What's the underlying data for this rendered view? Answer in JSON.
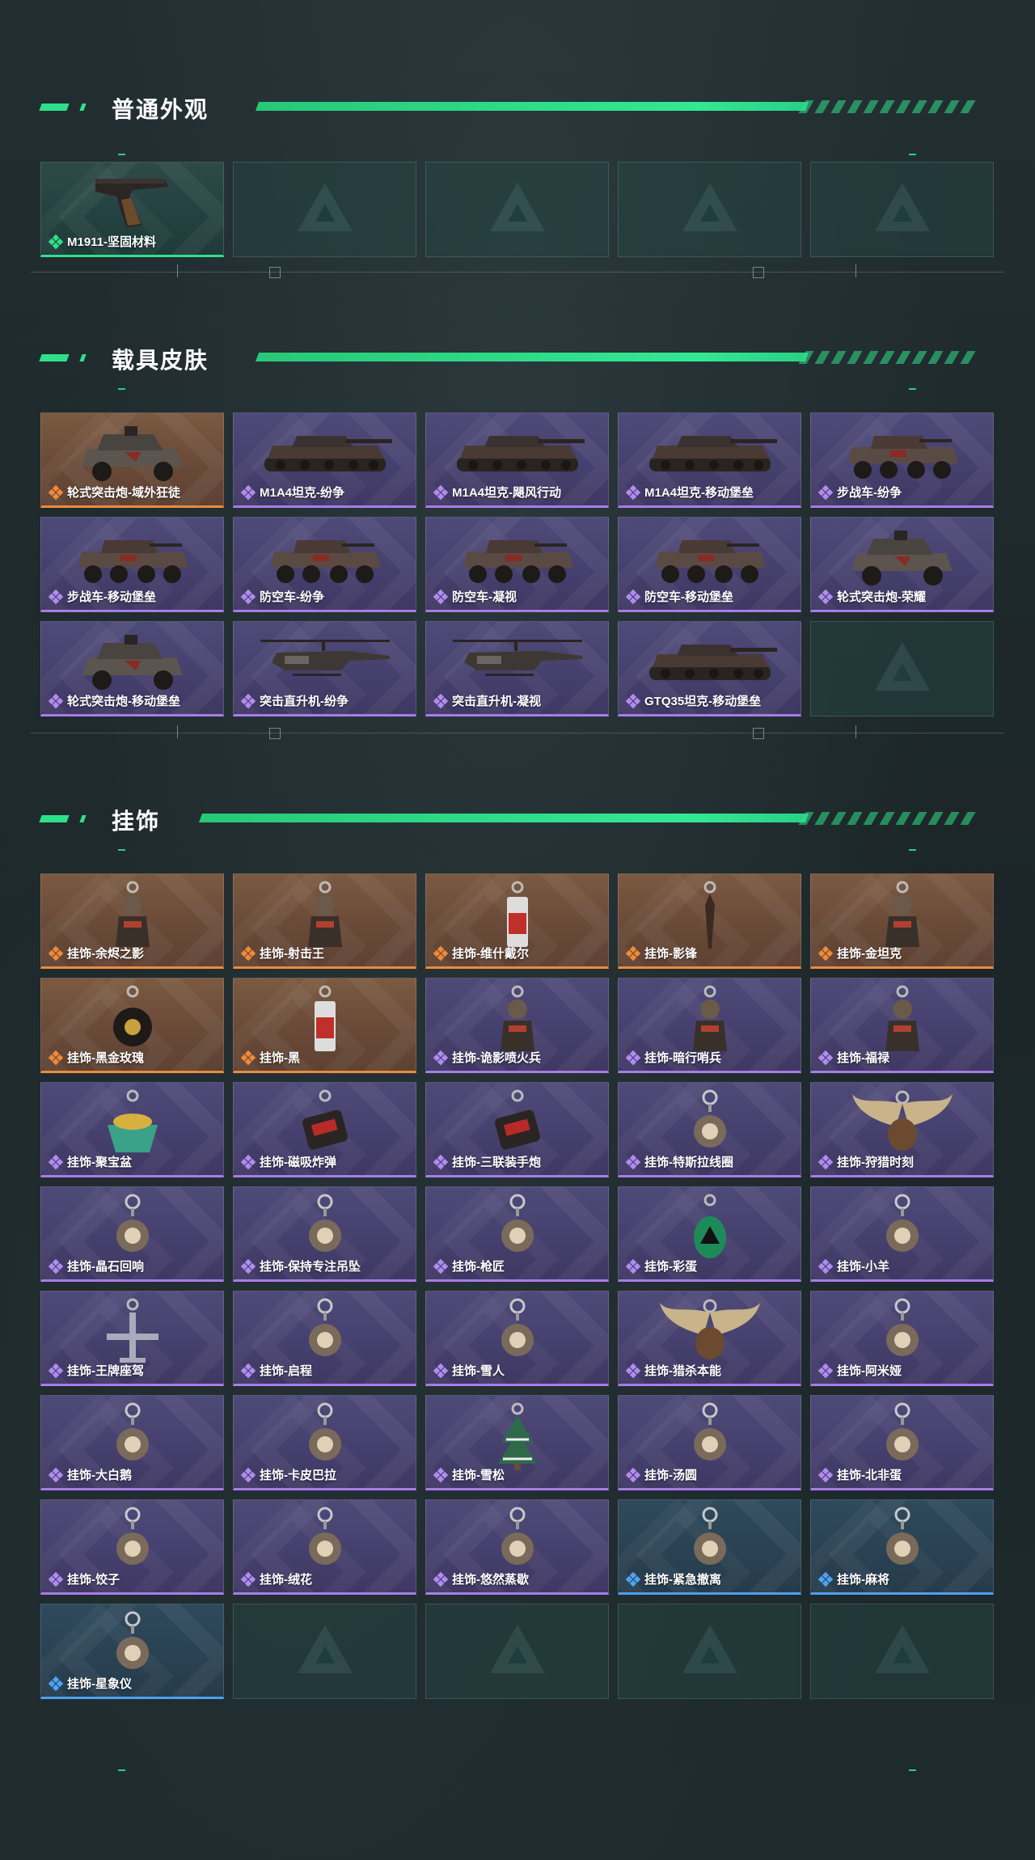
{
  "sections": [
    {
      "title": "普通外观",
      "items": [
        {
          "label": "M1911-坚固材料",
          "rarity": "green",
          "icon": "pistol-icon"
        },
        {
          "label": "",
          "rarity": "empty"
        },
        {
          "label": "",
          "rarity": "empty"
        },
        {
          "label": "",
          "rarity": "empty"
        },
        {
          "label": "",
          "rarity": "empty"
        }
      ]
    },
    {
      "title": "载具皮肤",
      "items": [
        {
          "label": "轮式突击炮-域外狂徒",
          "rarity": "orange",
          "icon": "armored-car-icon"
        },
        {
          "label": "M1A4坦克-纷争",
          "rarity": "purple",
          "icon": "tank-icon"
        },
        {
          "label": "M1A4坦克-飓风行动",
          "rarity": "purple",
          "icon": "tank-icon"
        },
        {
          "label": "M1A4坦克-移动堡垒",
          "rarity": "purple",
          "icon": "tank-icon"
        },
        {
          "label": "步战车-纷争",
          "rarity": "purple",
          "icon": "ifv-icon"
        },
        {
          "label": "步战车-移动堡垒",
          "rarity": "purple",
          "icon": "ifv-icon"
        },
        {
          "label": "防空车-纷争",
          "rarity": "purple",
          "icon": "ifv-icon"
        },
        {
          "label": "防空车-凝视",
          "rarity": "purple",
          "icon": "ifv-icon"
        },
        {
          "label": "防空车-移动堡垒",
          "rarity": "purple",
          "icon": "ifv-icon"
        },
        {
          "label": "轮式突击炮-荣耀",
          "rarity": "purple",
          "icon": "armored-car-icon"
        },
        {
          "label": "轮式突击炮-移动堡垒",
          "rarity": "purple",
          "icon": "armored-car-icon"
        },
        {
          "label": "突击直升机-纷争",
          "rarity": "purple",
          "icon": "helicopter-icon"
        },
        {
          "label": "突击直升机-凝视",
          "rarity": "purple",
          "icon": "helicopter-icon"
        },
        {
          "label": "GTQ35坦克-移动堡垒",
          "rarity": "purple",
          "icon": "tank-icon"
        },
        {
          "label": "",
          "rarity": "empty"
        }
      ]
    },
    {
      "title": "挂饰",
      "items": [
        {
          "label": "挂饰-余烬之影",
          "rarity": "orange",
          "icon": "charm-figure-icon"
        },
        {
          "label": "挂饰-射击王",
          "rarity": "orange",
          "icon": "charm-figure-icon"
        },
        {
          "label": "挂饰-维什戴尔",
          "rarity": "orange",
          "icon": "charm-tag-icon"
        },
        {
          "label": "挂饰-影锋",
          "rarity": "orange",
          "icon": "charm-blade-icon"
        },
        {
          "label": "挂饰-金坦克",
          "rarity": "orange",
          "icon": "charm-figure-icon"
        },
        {
          "label": "挂饰-黑金玫瑰",
          "rarity": "orange",
          "icon": "charm-rose-icon"
        },
        {
          "label": "挂饰-黑",
          "rarity": "orange",
          "icon": "charm-tag-icon"
        },
        {
          "label": "挂饰-诡影喷火兵",
          "rarity": "purple",
          "icon": "charm-figure-icon"
        },
        {
          "label": "挂饰-暗行哨兵",
          "rarity": "purple",
          "icon": "charm-figure-icon"
        },
        {
          "label": "挂饰-福禄",
          "rarity": "purple",
          "icon": "charm-figure-icon"
        },
        {
          "label": "挂饰-聚宝盆",
          "rarity": "purple",
          "icon": "charm-bowl-icon"
        },
        {
          "label": "挂饰-磁吸炸弹",
          "rarity": "purple",
          "icon": "charm-bomb-icon"
        },
        {
          "label": "挂饰-三联装手炮",
          "rarity": "purple",
          "icon": "charm-bomb-icon"
        },
        {
          "label": "挂饰-特斯拉线圈",
          "rarity": "purple",
          "icon": "charm-ring-icon"
        },
        {
          "label": "挂饰-狩猎时刻",
          "rarity": "purple",
          "icon": "charm-antler-icon"
        },
        {
          "label": "挂饰-晶石回响",
          "rarity": "purple",
          "icon": "charm-ring-icon"
        },
        {
          "label": "挂饰-保持专注吊坠",
          "rarity": "purple",
          "icon": "charm-ring-icon"
        },
        {
          "label": "挂饰-枪匠",
          "rarity": "purple",
          "icon": "charm-ring-icon"
        },
        {
          "label": "挂饰-彩蛋",
          "rarity": "purple",
          "icon": "charm-egg-icon"
        },
        {
          "label": "挂饰-小羊",
          "rarity": "purple",
          "icon": "charm-ring-icon"
        },
        {
          "label": "挂饰-王牌座驾",
          "rarity": "purple",
          "icon": "charm-plane-icon"
        },
        {
          "label": "挂饰-启程",
          "rarity": "purple",
          "icon": "charm-ring-icon"
        },
        {
          "label": "挂饰-雪人",
          "rarity": "purple",
          "icon": "charm-ring-icon"
        },
        {
          "label": "挂饰-猎杀本能",
          "rarity": "purple",
          "icon": "charm-antler-icon"
        },
        {
          "label": "挂饰-阿米娅",
          "rarity": "purple",
          "icon": "charm-ring-icon"
        },
        {
          "label": "挂饰-大白鹅",
          "rarity": "purple",
          "icon": "charm-ring-icon"
        },
        {
          "label": "挂饰-卡皮巴拉",
          "rarity": "purple",
          "icon": "charm-ring-icon"
        },
        {
          "label": "挂饰-雪松",
          "rarity": "purple",
          "icon": "charm-tree-icon"
        },
        {
          "label": "挂饰-汤圆",
          "rarity": "purple",
          "icon": "charm-ring-icon"
        },
        {
          "label": "挂饰-北非蛋",
          "rarity": "purple",
          "icon": "charm-ring-icon"
        },
        {
          "label": "挂饰-饺子",
          "rarity": "purple",
          "icon": "charm-ring-icon"
        },
        {
          "label": "挂饰-绒花",
          "rarity": "purple",
          "icon": "charm-ring-icon"
        },
        {
          "label": "挂饰-悠然蒸歇",
          "rarity": "purple",
          "icon": "charm-ring-icon"
        },
        {
          "label": "挂饰-紧急撤离",
          "rarity": "blue",
          "icon": "charm-ring-icon"
        },
        {
          "label": "挂饰-麻将",
          "rarity": "blue",
          "icon": "charm-ring-icon"
        },
        {
          "label": "挂饰-星象仪",
          "rarity": "blue",
          "icon": "charm-ring-icon"
        },
        {
          "label": "",
          "rarity": "empty"
        },
        {
          "label": "",
          "rarity": "empty"
        },
        {
          "label": "",
          "rarity": "empty"
        },
        {
          "label": "",
          "rarity": "empty"
        }
      ]
    }
  ],
  "colors": {
    "accent": "#2fe08a",
    "orange": "#ee8a3c",
    "purple": "#a77ce9",
    "blue": "#4d9ff0"
  }
}
